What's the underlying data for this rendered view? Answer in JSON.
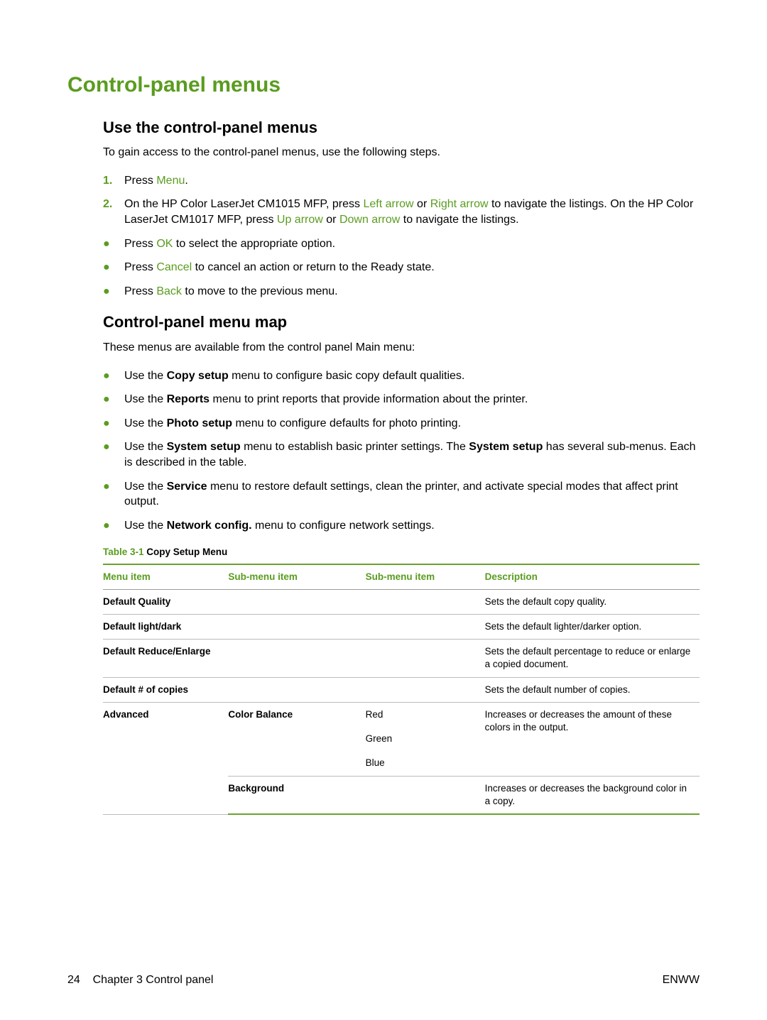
{
  "title": "Control-panel menus",
  "section1": {
    "heading": "Use the control-panel menus",
    "intro": "To gain access to the control-panel menus, use the following steps.",
    "step1_pre": "Press ",
    "step1_menu": "Menu",
    "step1_post": ".",
    "step2_a": "On the HP Color LaserJet CM1015 MFP, press ",
    "step2_left": "Left arrow",
    "step2_or1": " or ",
    "step2_right": "Right arrow",
    "step2_nav": " to navigate the listings. On the HP Color LaserJet CM1017 MFP, press ",
    "step2_up": "Up arrow",
    "step2_or2": " or ",
    "step2_down": "Down arrow",
    "step2_end": " to navigate the listings.",
    "b1_pre": "Press ",
    "b1_ok": "OK",
    "b1_post": " to select the appropriate option.",
    "b2_pre": "Press ",
    "b2_cancel": "Cancel",
    "b2_post": " to cancel an action or return to the Ready state.",
    "b3_pre": "Press ",
    "b3_back": "Back",
    "b3_post": " to move to the previous menu."
  },
  "section2": {
    "heading": "Control-panel menu map",
    "intro": "These menus are available from the control panel Main menu:",
    "items": [
      {
        "pre": "Use the ",
        "bold": "Copy setup",
        "post": " menu to configure basic copy default qualities."
      },
      {
        "pre": "Use the ",
        "bold": "Reports",
        "post": " menu to print reports that provide information about the printer."
      },
      {
        "pre": "Use the ",
        "bold": "Photo setup",
        "post": " menu to configure defaults for photo printing."
      },
      {
        "pre": "Use the ",
        "bold": "System setup",
        "post": " menu to establish basic printer settings. The ",
        "bold2": "System setup",
        "post2": " has several sub-menus. Each is described in the table."
      },
      {
        "pre": "Use the ",
        "bold": "Service",
        "post": " menu to restore default settings, clean the printer, and activate special modes that affect print output."
      },
      {
        "pre": "Use the ",
        "bold": "Network config.",
        "post": " menu to configure network settings."
      }
    ]
  },
  "table": {
    "caption_label": "Table 3-1",
    "caption_title": "  Copy Setup Menu",
    "headers": [
      "Menu item",
      "Sub-menu item",
      "Sub-menu item",
      "Description"
    ],
    "rows": [
      {
        "menu": "Default Quality",
        "sub1": "",
        "sub2": "",
        "desc": "Sets the default copy quality."
      },
      {
        "menu": "Default light/dark",
        "sub1": "",
        "sub2": "",
        "desc": "Sets the default lighter/darker option."
      },
      {
        "menu": "Default Reduce/Enlarge",
        "sub1": "",
        "sub2": "",
        "desc": "Sets the default percentage to reduce or enlarge a copied document."
      },
      {
        "menu": "Default # of copies",
        "sub1": "",
        "sub2": "",
        "desc": "Sets the default number of copies."
      }
    ],
    "advanced": {
      "menu": "Advanced",
      "sub1": "Color Balance",
      "sub2_red": "Red",
      "sub2_green": "Green",
      "sub2_blue": "Blue",
      "desc1": "Increases or decreases the amount of these colors in the output.",
      "sub1b": "Background",
      "desc2": "Increases or decreases the background color in a copy."
    }
  },
  "footer": {
    "page": "24",
    "chapter": "Chapter 3   Control panel",
    "right": "ENWW"
  }
}
